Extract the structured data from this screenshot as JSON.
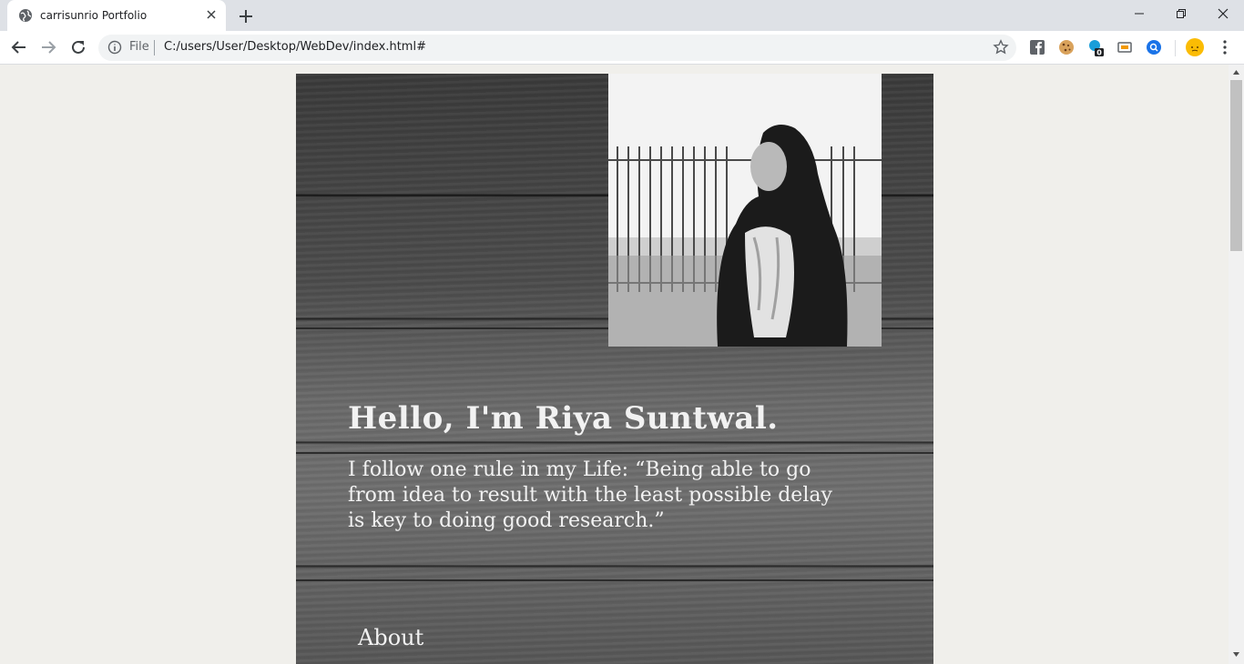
{
  "browser": {
    "tab_title": "carrisunrio Portfolio",
    "omnibox": {
      "scheme_label": "File",
      "url": "C:/users/User/Desktop/WebDev/index.html#"
    },
    "extensions": [
      "facebook-icon",
      "cookie-icon",
      "counter-extension-icon",
      "cast-icon",
      "search-extension-icon",
      "profile-avatar-icon"
    ],
    "extension_badge": "0"
  },
  "page": {
    "greeting": "Hello, I'm Riya Suntwal.",
    "quote": "I follow one rule in my Life: “Being able to go from idea to result with the least possible delay is key to doing good research.”",
    "nav_about": "About"
  },
  "colors": {
    "page_background": "#f0efeb",
    "hero_text": "#f2f2f2",
    "tabstrip": "#dee1e6"
  }
}
